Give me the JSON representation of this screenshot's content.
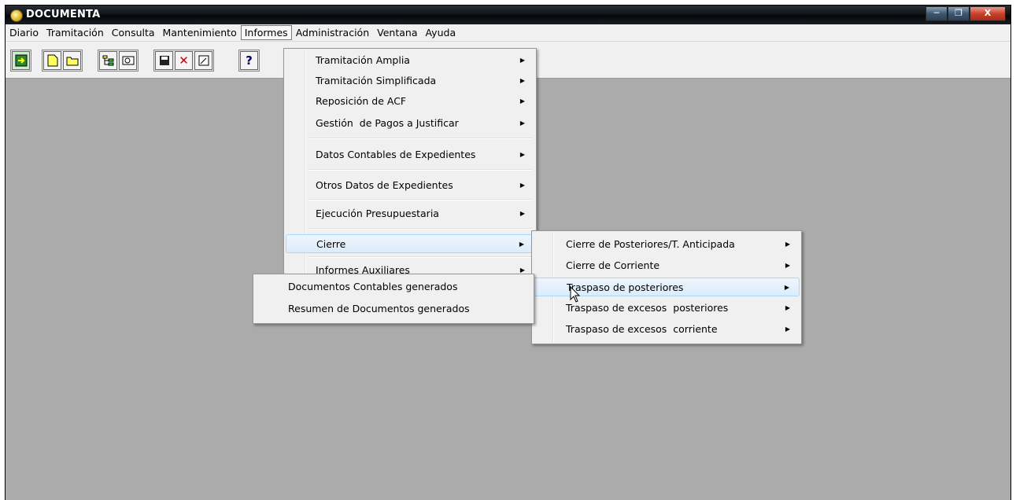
{
  "window": {
    "title": "DOCUMENTA",
    "controls": [
      "minimize",
      "restore",
      "close"
    ]
  },
  "menubar": [
    "Diario",
    "Tramitación",
    "Consulta",
    "Mantenimiento",
    "Informes",
    "Administración",
    "Ventana",
    "Ayuda"
  ],
  "active_menu": "Informes",
  "toolbar": {
    "groups": [
      [
        "exit-icon"
      ],
      [
        "new-document-icon",
        "open-folder-icon"
      ],
      [
        "tree-view-icon",
        "search-view-icon"
      ],
      [
        "save-icon",
        "delete-icon",
        "edit-icon"
      ],
      [
        "help-icon"
      ]
    ]
  },
  "informes_menu": {
    "items": [
      "Tramitación Amplia",
      "Tramitación Simplificada",
      "Reposición de ACF",
      "Gestión  de Pagos a Justificar",
      "Datos Contables de Expedientes",
      "Otros Datos de Expedientes",
      "Ejecución Presupuestaria",
      "Cierre",
      "Informes Auxiliares"
    ],
    "highlighted": "Cierre"
  },
  "cierre_menu": {
    "items": [
      "Cierre de Posteriores/T. Anticipada",
      "Cierre de Corriente",
      "Traspaso de posteriores",
      "Traspaso de excesos  posteriores",
      "Traspaso de excesos  corriente"
    ],
    "highlighted": "Traspaso de posteriores"
  },
  "traspaso_menu": {
    "items": [
      "Documentos Contables generados",
      "Resumen de Documentos generados"
    ]
  }
}
